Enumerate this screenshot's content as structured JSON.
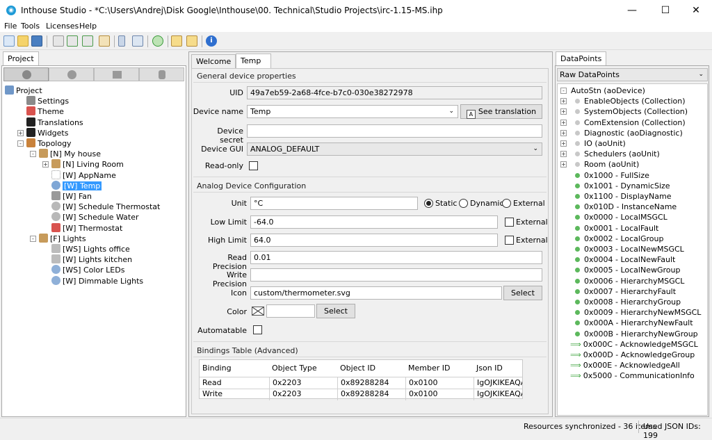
{
  "window": {
    "title": "Inthouse Studio - *C:\\Users\\Andrej\\Disk Google\\Inthouse\\00. Technical\\Studio Projects\\irc-1.15-MS.ihp",
    "minimize": "—",
    "maximize": "☐",
    "close": "✕"
  },
  "menu": [
    "File",
    "Tools",
    "Licenses",
    "Help"
  ],
  "project_panel": {
    "tab": "Project",
    "tree": [
      {
        "label": "Project",
        "level": 0,
        "icon": "project-icon"
      },
      {
        "label": "Settings",
        "level": 1,
        "icon": "wrench-icon"
      },
      {
        "label": "Theme",
        "level": 1,
        "icon": "palette-icon"
      },
      {
        "label": "Translations",
        "level": 1,
        "icon": "letter-a-icon"
      },
      {
        "label": "Widgets",
        "level": 1,
        "icon": "info-icon",
        "expander": "+"
      },
      {
        "label": "Topology",
        "level": 1,
        "icon": "house-icon",
        "expander": "-"
      },
      {
        "label": "[N] My house",
        "level": 2,
        "icon": "node-icon",
        "expander": "-"
      },
      {
        "label": "[N] Living Room",
        "level": 3,
        "icon": "node-icon",
        "expander": "+"
      },
      {
        "label": "[W] AppName",
        "level": 3,
        "icon": "blank-widget-icon"
      },
      {
        "label": "[W] Temp",
        "level": 3,
        "icon": "thermo-widget-icon",
        "selected": true
      },
      {
        "label": "[W] Fan",
        "level": 3,
        "icon": "fan-widget-icon"
      },
      {
        "label": "[W] Schedule Thermostat",
        "level": 3,
        "icon": "clock-widget-icon"
      },
      {
        "label": "[W] Schedule Water",
        "level": 3,
        "icon": "clock-widget-icon"
      },
      {
        "label": "[W] Thermostat",
        "level": 3,
        "icon": "thermostat-widget-icon"
      },
      {
        "label": "[F] Lights",
        "level": 2,
        "icon": "floor-icon",
        "expander": "-"
      },
      {
        "label": "[WS] Lights office",
        "level": 3,
        "icon": "switch-widget-icon"
      },
      {
        "label": "[W] Lights kitchen",
        "level": 3,
        "icon": "switch-widget-icon"
      },
      {
        "label": "[WS] Color LEDs",
        "level": 3,
        "icon": "light-widget-icon"
      },
      {
        "label": "[W] Dimmable Lights",
        "level": 3,
        "icon": "light-widget-icon"
      }
    ]
  },
  "editor": {
    "tabs": [
      {
        "label": "Welcome",
        "close": "✕"
      },
      {
        "label": "Temp",
        "close": "✕",
        "active": true
      }
    ],
    "general": {
      "title": "General device properties",
      "uid_label": "UID",
      "uid_value": "49a7eb59-2a68-4fce-b7c0-030e38272978",
      "device_name_label": "Device name",
      "device_name_value": "Temp",
      "see_translation": "See translation",
      "device_secret_label": "Device secret",
      "device_secret_value": "",
      "device_gui_label": "Device GUI",
      "device_gui_value": "ANALOG_DEFAULT",
      "readonly_label": "Read-only"
    },
    "analog": {
      "title": "Analog Device Configuration",
      "unit_label": "Unit",
      "unit_value": "°C",
      "static": "Static",
      "dynamic": "Dynamic",
      "external": "External",
      "low_limit_label": "Low Limit",
      "low_limit_value": "-64.0",
      "high_limit_label": "High Limit",
      "high_limit_value": "64.0",
      "read_precision_label": "Read Precision",
      "read_precision_value": "0.01",
      "write_precision_label": "Write Precision",
      "write_precision_value": "",
      "icon_label": "Icon",
      "icon_value": "custom/thermometer.svg",
      "select": "Select",
      "color_label": "Color",
      "automatable_label": "Automatable"
    },
    "bindings": {
      "title": "Bindings Table (Advanced)",
      "columns": [
        "Binding",
        "Object Type",
        "Object ID",
        "Member ID",
        "Json ID"
      ],
      "rows": [
        [
          "Read",
          "0x2203",
          "0x89288284",
          "0x0100",
          "IgOJKIKEAQA-"
        ],
        [
          "Write",
          "0x2203",
          "0x89288284",
          "0x0100",
          "IgOJKIKEAQA-"
        ]
      ]
    }
  },
  "datapoints": {
    "tab": "DataPoints",
    "dropdown": "Raw DataPoints",
    "items": [
      {
        "label": "AutoStn (aoDevice)",
        "kind": "root"
      },
      {
        "label": "EnableObjects (Collection)",
        "kind": "group"
      },
      {
        "label": "SystemObjects (Collection)",
        "kind": "group"
      },
      {
        "label": "ComExtension (Collection)",
        "kind": "group"
      },
      {
        "label": "Diagnostic (aoDiagnostic)",
        "kind": "group"
      },
      {
        "label": "IO (aoUnit)",
        "kind": "group"
      },
      {
        "label": "Schedulers (aoUnit)",
        "kind": "group"
      },
      {
        "label": "Room (aoUnit)",
        "kind": "group"
      },
      {
        "label": "0x1000 - FullSize",
        "kind": "point"
      },
      {
        "label": "0x1001 - DynamicSize",
        "kind": "point"
      },
      {
        "label": "0x1100 - DisplayName",
        "kind": "point"
      },
      {
        "label": "0x010D - InstanceName",
        "kind": "point"
      },
      {
        "label": "0x0000 - LocalMSGCL",
        "kind": "point"
      },
      {
        "label": "0x0001 - LocalFault",
        "kind": "point"
      },
      {
        "label": "0x0002 - LocalGroup",
        "kind": "point"
      },
      {
        "label": "0x0003 - LocalNewMSGCL",
        "kind": "point"
      },
      {
        "label": "0x0004 - LocalNewFault",
        "kind": "point"
      },
      {
        "label": "0x0005 - LocalNewGroup",
        "kind": "point"
      },
      {
        "label": "0x0006 - HierarchyMSGCL",
        "kind": "point"
      },
      {
        "label": "0x0007 - HierarchyFault",
        "kind": "point"
      },
      {
        "label": "0x0008 - HierarchyGroup",
        "kind": "point"
      },
      {
        "label": "0x0009 - HierarchyNewMSGCL",
        "kind": "point"
      },
      {
        "label": "0x000A - HierarchyNewFault",
        "kind": "point"
      },
      {
        "label": "0x000B - HierarchyNewGroup",
        "kind": "point"
      },
      {
        "label": "0x000C - AcknowledgeMSGCL",
        "kind": "arrow"
      },
      {
        "label": "0x000D - AcknowledgeGroup",
        "kind": "arrow"
      },
      {
        "label": "0x000E - AcknowledgeAll",
        "kind": "arrow"
      },
      {
        "label": "0x5000 - CommunicationInfo",
        "kind": "arrow"
      }
    ]
  },
  "status": {
    "sync": "Resources synchronized - 36 items",
    "json_ids": "Used JSON IDs: 199"
  },
  "colors": {
    "selection": "#3399ff",
    "point_green": "#5cb85c",
    "arrow_green": "#3aa33a"
  }
}
